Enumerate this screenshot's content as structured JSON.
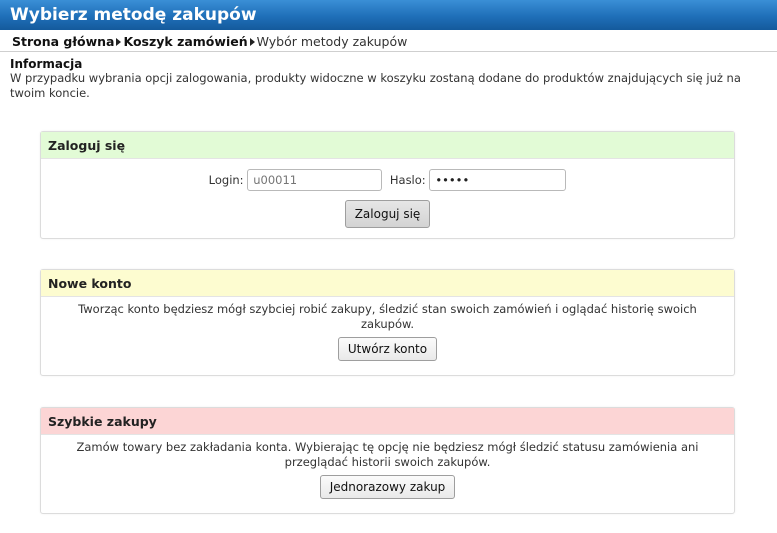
{
  "header": {
    "title": "Wybierz metodę zakupów"
  },
  "breadcrumb": {
    "items": [
      "Strona główna",
      "Koszyk zamówień"
    ],
    "current": "Wybór metody zakupów"
  },
  "info": {
    "heading": "Informacja",
    "text": "W przypadku wybrania opcji zalogowania, produkty widoczne w koszyku zostaną dodane do produktów znajdujących się już na twoim koncie."
  },
  "login_box": {
    "title": "Zaloguj się",
    "login_label": "Login:",
    "login_placeholder": "u00011",
    "password_label": "Haslo:",
    "password_value": "•••••",
    "submit_label": "Zaloguj się"
  },
  "new_account_box": {
    "title": "Nowe konto",
    "description": "Tworząc konto będziesz mógł szybciej robić zakupy, śledzić stan swoich zamówień i oglądać historię swoich zakupów.",
    "button_label": "Utwórz konto"
  },
  "quick_purchase_box": {
    "title": "Szybkie zakupy",
    "description": "Zamów towary bez zakładania konta. Wybierając tę opcję nie będziesz mógł śledzić statusu zamówienia ani przeglądać historii swoich zakupów.",
    "button_label": "Jednorazowy zakup"
  },
  "colors": {
    "title_bar": "#1f6fb8",
    "login_header": "#e2fbd6",
    "new_account_header": "#fdfcd0",
    "quick_purchase_header": "#fcd5d5"
  }
}
